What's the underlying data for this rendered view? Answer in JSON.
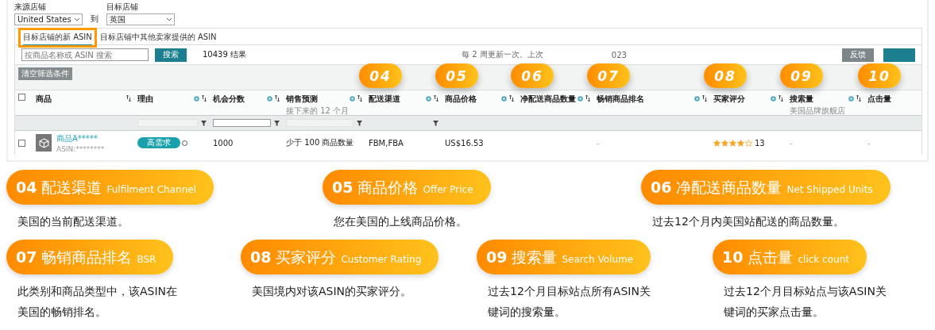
{
  "source_store": {
    "label": "来源店铺",
    "value": "United States"
  },
  "to_label": "到",
  "target_store": {
    "label": "目标店铺",
    "value": "英国"
  },
  "tabs": [
    {
      "label": "目标店铺的新 ASIN",
      "selected": true
    },
    {
      "label": "目标店铺中其他卖家提供的 ASIN",
      "selected": false
    }
  ],
  "search": {
    "placeholder": "按商品名称或 ASIN 搜索"
  },
  "search_button": "搜索",
  "result_count": "10439 结果",
  "update_note": [
    "每 2 周更新一次。上次",
    "023"
  ],
  "feedback_button": "反馈",
  "clear_filters_button": "清空筛选条件",
  "select_all": {
    "checked": false
  },
  "columns": [
    {
      "label": "商品",
      "info": false,
      "sortable": true
    },
    {
      "label": "理由",
      "info": true,
      "sortable": true,
      "filter": {
        "kind": "field",
        "disabled": true
      }
    },
    {
      "label": "机会分数",
      "info": true,
      "sortable": true,
      "filter": {
        "kind": "field",
        "disabled": false
      }
    },
    {
      "label": "销售预测",
      "sublabel": "接下来的 12 个月",
      "info": true,
      "sortable": true,
      "filter": {
        "kind": "field",
        "disabled": true
      }
    },
    {
      "label": "配送渠道",
      "info": true,
      "sortable": true,
      "filter": {
        "kind": "icon"
      },
      "badge": "04"
    },
    {
      "label": "商品价格",
      "info": true,
      "sortable": true,
      "badge": "05"
    },
    {
      "label": "净配送商品数量",
      "info": true,
      "sortable": true,
      "badge": "06"
    },
    {
      "label": "畅销商品排名",
      "info": true,
      "sortable": true,
      "badge": "07"
    },
    {
      "label": "买家评分",
      "info": true,
      "sortable": true,
      "badge": "08"
    },
    {
      "label": "搜索量",
      "sublabel": "美国品牌旗舰店",
      "info": true,
      "sortable": true,
      "badge": "09"
    },
    {
      "label": "点击量",
      "info": false,
      "sortable": false,
      "badge": "10"
    }
  ],
  "row": {
    "checked": false,
    "product_name": "商品A*****",
    "asin": "ASIN:********",
    "reason": "高需求",
    "opportunity_score": "1000",
    "sales_forecast": "少于 100 商品数量",
    "fulfilment": "FBM,FBA",
    "price": "US$16.53",
    "bsr": "-",
    "stars": 4,
    "rating_count": "13",
    "search_volume": "-",
    "clicks": "-"
  },
  "annotations": [
    {
      "number": "04",
      "title": "配送渠道",
      "english": "Fulfilment Channel",
      "description": "美国的当前配送渠道。"
    },
    {
      "number": "05",
      "title": "商品价格",
      "english": "Offer Price",
      "description": "您在美国的上线商品价格。"
    },
    {
      "number": "06",
      "title": "净配送商品数量",
      "english": "Net Shipped Units",
      "description": "过去12个月内美国站配送的商品数量。"
    },
    {
      "number": "07",
      "title": "畅销商品排名",
      "english": "BSR",
      "description": "此类别和商品类型中，该ASIN在美国的畅销排名。"
    },
    {
      "number": "08",
      "title": "买家评分",
      "english": "Customer Rating",
      "description": "美国境内对该ASIN的买家评分。"
    },
    {
      "number": "09",
      "title": "搜索量",
      "english": "Search Volume",
      "description": "过去12个月目标站点所有ASIN关键词的搜索量。"
    },
    {
      "number": "10",
      "title": "点击量",
      "english": "click count",
      "description": "过去12个月目标站点与该ASIN关键词的买家点击量。"
    }
  ]
}
